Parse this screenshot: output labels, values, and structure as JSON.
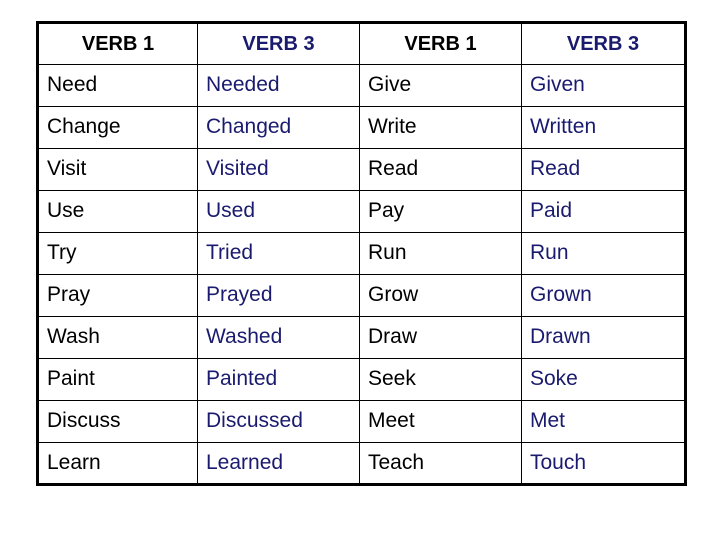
{
  "colors": {
    "base_text": "#000000",
    "participle_text": "#1a1a6e",
    "border": "#000000",
    "background": "#ffffff"
  },
  "table": {
    "headers": [
      {
        "label": "VERB 1",
        "variant": "base"
      },
      {
        "label": "VERB 3",
        "variant": "participle"
      },
      {
        "label": "VERB 1",
        "variant": "base"
      },
      {
        "label": "VERB 3",
        "variant": "participle"
      }
    ],
    "rows": [
      {
        "c0": "Need",
        "c1": "Needed",
        "c2": "Give",
        "c3": "Given"
      },
      {
        "c0": "Change",
        "c1": "Changed",
        "c2": "Write",
        "c3": "Written"
      },
      {
        "c0": "Visit",
        "c1": "Visited",
        "c2": "Read",
        "c3": "Read"
      },
      {
        "c0": "Use",
        "c1": "Used",
        "c2": "Pay",
        "c3": "Paid"
      },
      {
        "c0": "Try",
        "c1": "Tried",
        "c2": "Run",
        "c3": "Run"
      },
      {
        "c0": "Pray",
        "c1": "Prayed",
        "c2": "Grow",
        "c3": "Grown"
      },
      {
        "c0": "Wash",
        "c1": "Washed",
        "c2": "Draw",
        "c3": "Drawn"
      },
      {
        "c0": "Paint",
        "c1": "Painted",
        "c2": "Seek",
        "c3": "Soke"
      },
      {
        "c0": "Discuss",
        "c1": "Discussed",
        "c2": "Meet",
        "c3": "Met"
      },
      {
        "c0": "Learn",
        "c1": "Learned",
        "c2": "Teach",
        "c3": "Touch"
      }
    ]
  }
}
